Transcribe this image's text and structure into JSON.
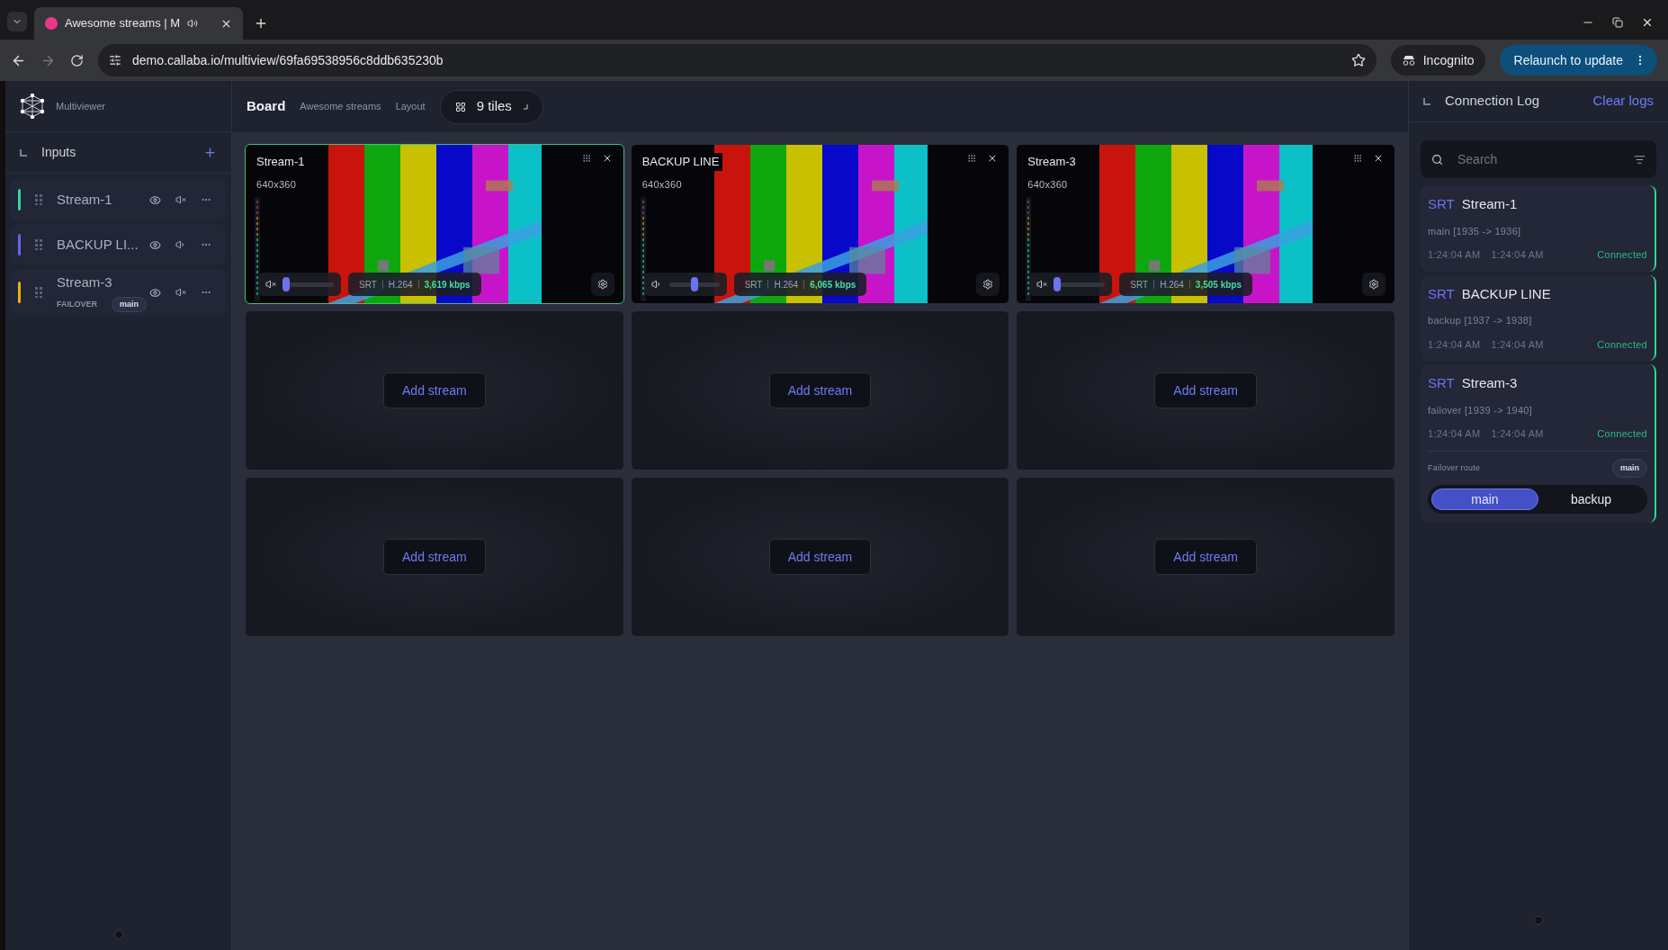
{
  "browser": {
    "tab_title": "Awesome streams | M",
    "url": "demo.callaba.io/multiview/69fa69538956c8ddb635230b",
    "incognito": "Incognito",
    "relaunch": "Relaunch to update"
  },
  "sidebar": {
    "app_name": "Multiviewer",
    "inputs_title": "Inputs",
    "inputs": [
      {
        "name": "Stream-1",
        "color": "#34d399",
        "muted": true
      },
      {
        "name": "BACKUP LI...",
        "color": "#6366f1",
        "muted": false
      },
      {
        "name": "Stream-3",
        "color": "#eab308",
        "muted": true,
        "type_label": "FAILOVER",
        "route": "main"
      }
    ]
  },
  "board": {
    "tabs": [
      {
        "label": "Board",
        "selected": true
      },
      {
        "label": "Awesome streams",
        "selected": false
      },
      {
        "label": "Layout",
        "selected": false
      }
    ],
    "tiles_button": "9 tiles"
  },
  "tiles": [
    {
      "kind": "stream",
      "title": "Stream-1",
      "resolution": "640x360",
      "protocol": "SRT",
      "codec": "H.264",
      "bitrate": "3,619 kbps",
      "muted": true,
      "level": 0.05,
      "selected": true
    },
    {
      "kind": "stream",
      "title": "BACKUP LINE",
      "resolution": "640x360",
      "protocol": "SRT",
      "codec": "H.264",
      "bitrate": "6,065 kbps",
      "muted": false,
      "level": 0.5,
      "selected": false
    },
    {
      "kind": "stream",
      "title": "Stream-3",
      "resolution": "640x360",
      "protocol": "SRT",
      "codec": "H.264",
      "bitrate": "3,505 kbps",
      "muted": true,
      "level": 0.05,
      "selected": false
    },
    {
      "kind": "empty",
      "button": "Add stream"
    },
    {
      "kind": "empty",
      "button": "Add stream"
    },
    {
      "kind": "empty",
      "button": "Add stream"
    },
    {
      "kind": "empty",
      "button": "Add stream"
    },
    {
      "kind": "empty",
      "button": "Add stream"
    },
    {
      "kind": "empty",
      "button": "Add stream"
    }
  ],
  "log": {
    "title": "Connection Log",
    "clear": "Clear logs",
    "search_placeholder": "Search",
    "entries": [
      {
        "protocol": "SRT",
        "name": "Stream-1",
        "route": "main [1935 -> 1936]",
        "started": "1:24:04 AM",
        "updated": "1:24:04 AM",
        "status": "Connected"
      },
      {
        "protocol": "SRT",
        "name": "BACKUP LINE",
        "route": "backup [1937 -> 1938]",
        "started": "1:24:04 AM",
        "updated": "1:24:04 AM",
        "status": "Connected"
      },
      {
        "protocol": "SRT",
        "name": "Stream-3",
        "route": "failover [1939 -> 1940]",
        "started": "1:24:04 AM",
        "updated": "1:24:04 AM",
        "status": "Connected",
        "failover": {
          "label": "Failover route",
          "badge": "main",
          "options": [
            {
              "label": "main",
              "selected": true
            },
            {
              "label": "backup",
              "selected": false
            }
          ]
        }
      }
    ]
  }
}
